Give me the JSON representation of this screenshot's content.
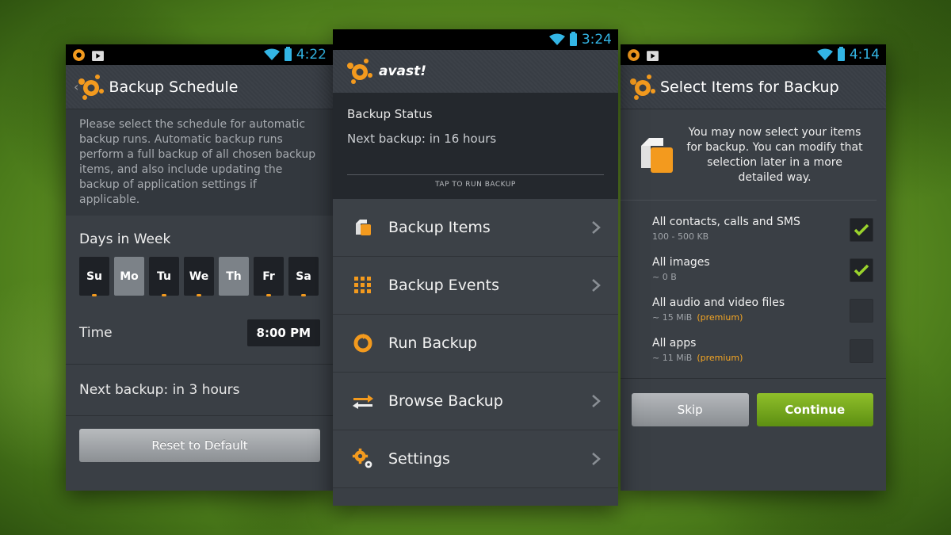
{
  "left_screen": {
    "status_time": "4:22",
    "title": "Backup Schedule",
    "description": "Please select the schedule for automatic backup runs. Automatic backup runs perform a full backup of all chosen backup items, and also include updating the backup of application settings if applicable.",
    "days_label": "Days in Week",
    "days": [
      {
        "label": "Su",
        "selected": false
      },
      {
        "label": "Mo",
        "selected": true
      },
      {
        "label": "Tu",
        "selected": false
      },
      {
        "label": "We",
        "selected": false
      },
      {
        "label": "Th",
        "selected": true
      },
      {
        "label": "Fr",
        "selected": false
      },
      {
        "label": "Sa",
        "selected": false
      }
    ],
    "time_label": "Time",
    "time_value": "8:00 PM",
    "next_backup": "Next backup: in 3 hours",
    "reset_button": "Reset to Default"
  },
  "middle_screen": {
    "status_time": "3:24",
    "brand": "avast!",
    "backup_status_title": "Backup Status",
    "next_backup": "Next backup: in 16 hours",
    "tap_label": "TAP TO RUN BACKUP",
    "menu": [
      {
        "label": "Backup Items",
        "icon": "backup-items-icon"
      },
      {
        "label": "Backup Events",
        "icon": "grid-icon"
      },
      {
        "label": "Run Backup",
        "icon": "refresh-icon"
      },
      {
        "label": "Browse Backup",
        "icon": "swap-arrows-icon"
      },
      {
        "label": "Settings",
        "icon": "gears-icon"
      }
    ]
  },
  "right_screen": {
    "status_time": "4:14",
    "title": "Select Items for Backup",
    "intro": "You may now select your items for backup. You can modify that selection later in a more detailed way.",
    "items": [
      {
        "name": "All contacts, calls and SMS",
        "size": "100 - 500 KB",
        "premium": "",
        "checked": true
      },
      {
        "name": "All images",
        "size": "~ 0 B",
        "premium": "",
        "checked": true
      },
      {
        "name": "All audio and video files",
        "size": "~ 15 MiB",
        "premium": "(premium)",
        "checked": false
      },
      {
        "name": "All apps",
        "size": "~ 11 MiB",
        "premium": "(premium)",
        "checked": false
      }
    ],
    "skip_button": "Skip",
    "continue_button": "Continue"
  },
  "colors": {
    "accent_orange": "#f39a1e",
    "status_blue": "#33b5e5",
    "check_green": "#9ad32c",
    "continue_green": "#76a81e"
  }
}
